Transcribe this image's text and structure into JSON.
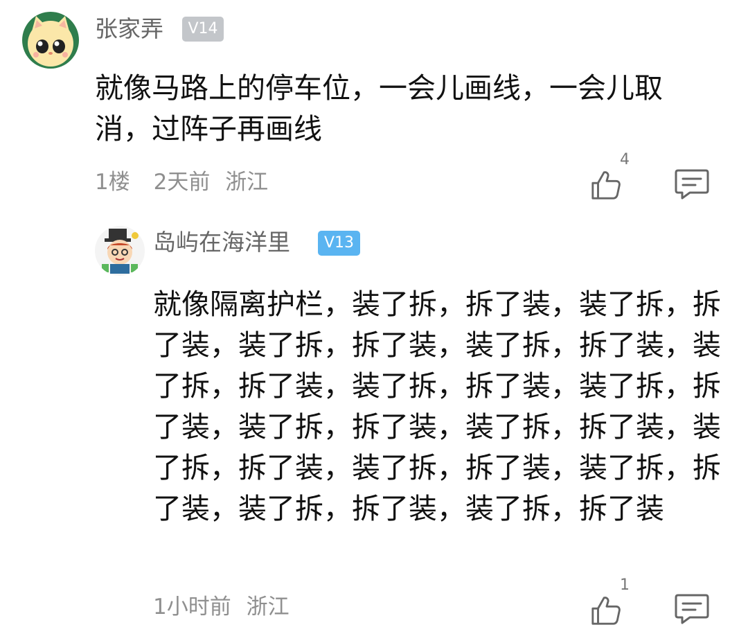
{
  "comment": {
    "user": {
      "name": "张家弄",
      "level": "V14",
      "avatar": "cartoon-cat-avatar"
    },
    "text": "就像马路上的停车位，一会儿画线，一会儿取消，过阵子再画线",
    "floor": "1楼",
    "time": "2天前",
    "location": "浙江",
    "likes": "4",
    "icons": {
      "like": "thumbs-up-icon",
      "reply": "reply-icon"
    }
  },
  "reply": {
    "user": {
      "name": "岛屿在海洋里",
      "level": "V13",
      "avatar": "cartoon-magician-avatar"
    },
    "text": "就像隔离护栏，装了拆，拆了装，装了拆，拆了装，装了拆，拆了装，装了拆，拆了装，装了拆，拆了装，装了拆，拆了装，装了拆，拆了装，装了拆，拆了装，装了拆，拆了装，装了拆，拆了装，装了拆，拆了装，装了拆，拆了装，装了拆，拆了装，装了拆，拆了装",
    "time": "1小时前",
    "location": "浙江",
    "likes": "1",
    "icons": {
      "like": "thumbs-up-icon",
      "reply": "reply-icon"
    }
  },
  "colors": {
    "level_badge_v14": "#c3c6ca",
    "level_badge_v13": "#5ab4f1",
    "meta_text": "#8f8f8f"
  }
}
